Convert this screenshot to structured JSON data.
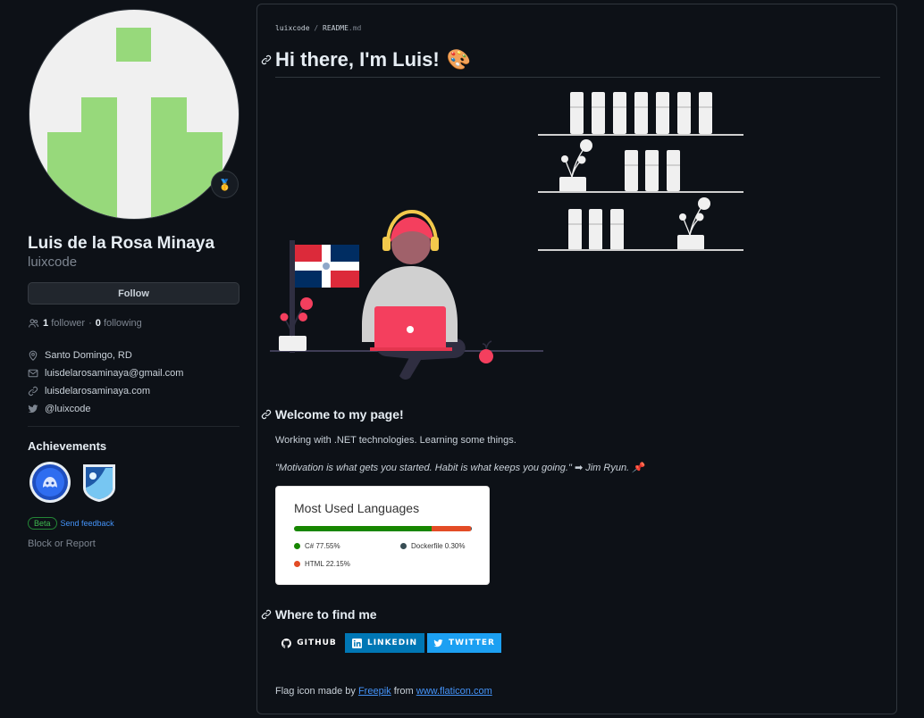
{
  "sidebar": {
    "name": "Luis de la Rosa Minaya",
    "login": "luixcode",
    "follow_label": "Follow",
    "followers_count": "1",
    "followers_label": "follower",
    "dot_sep": "·",
    "following_count": "0",
    "following_label": "following",
    "location": "Santo Domingo, RD",
    "email": "luisdelarosaminaya@gmail.com",
    "website": "luisdelarosaminaya.com",
    "twitter": "@luixcode",
    "achievements_title": "Achievements",
    "beta_label": "Beta",
    "feedback_label": "Send feedback",
    "block_label": "Block or Report"
  },
  "readme": {
    "path_user": "luixcode",
    "path_sep": "/",
    "path_file": "README",
    "path_ext": ".md",
    "title": "Hi there, I'm Luis!",
    "title_emoji": "🎨",
    "welcome_heading": "Welcome to my page!",
    "intro": "Working with .NET technologies. Learning some things.",
    "quote": "\"Motivation is what gets you started. Habit is what keeps you going.\"",
    "quote_arrow": "➡",
    "quote_author": "Jim Ryun.",
    "quote_pin": "📌",
    "find_heading": "Where to find me",
    "credit_prefix": "Flag icon made by",
    "credit_author": "Freepik",
    "credit_mid": "from",
    "credit_site": "www.flaticon.com"
  },
  "languages_card": {
    "title": "Most Used Languages",
    "languages": [
      {
        "name": "C#",
        "percent": 77.55,
        "label": "C# 77.55%",
        "color": "#178600"
      },
      {
        "name": "HTML",
        "percent": 22.15,
        "label": "HTML 22.15%",
        "color": "#e34c26"
      },
      {
        "name": "Dockerfile",
        "percent": 0.3,
        "label": "Dockerfile 0.30%",
        "color": "#384d54"
      }
    ]
  },
  "social_badges": {
    "github": {
      "label": "GITHUB",
      "color": "#0d1117",
      "icon": "github-icon"
    },
    "linkedin": {
      "label": "LINKEDIN",
      "color": "#0077b5",
      "icon": "linkedin-icon"
    },
    "twitter": {
      "label": "TWITTER",
      "color": "#1ca0f2",
      "icon": "twitter-icon"
    }
  },
  "colors": {
    "avatar_green": "#97d97b",
    "accent_red": "#f43f5e",
    "link_blue": "#4493f8"
  }
}
